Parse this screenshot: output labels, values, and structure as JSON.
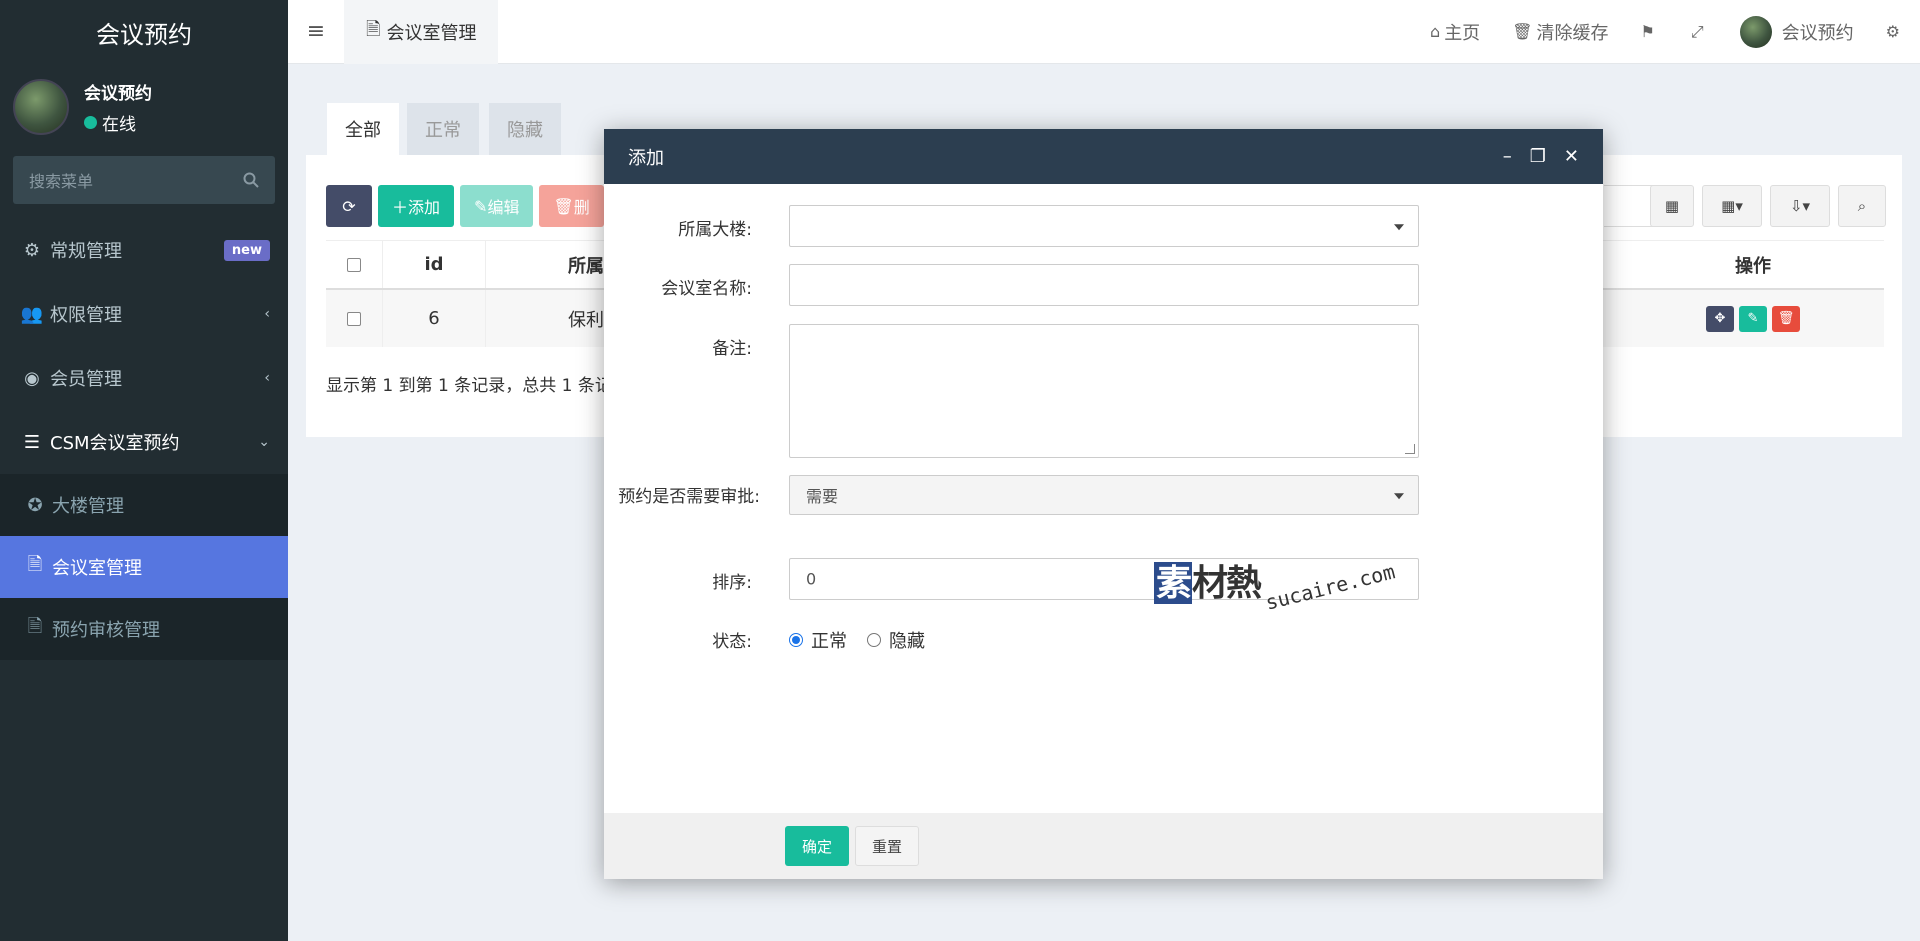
{
  "sidebar": {
    "logo": "会议预约",
    "user": {
      "name": "会议预约",
      "status": "在线"
    },
    "search_placeholder": "搜索菜单",
    "menu": [
      {
        "label": "常规管理",
        "badge": "new",
        "icon": "cogs-icon"
      },
      {
        "label": "权限管理",
        "icon": "users-icon"
      },
      {
        "label": "会员管理",
        "icon": "user-circle-icon"
      },
      {
        "label": "CSM会议室预约",
        "icon": "list-icon"
      }
    ],
    "submenu": [
      {
        "label": "大楼管理",
        "icon": "circle-gear-icon"
      },
      {
        "label": "会议室管理",
        "icon": "file-icon",
        "active": true
      },
      {
        "label": "预约审核管理",
        "icon": "file-icon"
      }
    ]
  },
  "header": {
    "tab": "会议室管理",
    "nav": {
      "home": "主页",
      "clear_cache": "清除缓存",
      "user": "会议预约"
    }
  },
  "content": {
    "tabs": [
      "全部",
      "正常",
      "隐藏"
    ],
    "toolbar": {
      "add": "添加",
      "edit": "编辑",
      "delete": "删"
    },
    "table": {
      "headers": {
        "id": "id",
        "building": "所属",
        "ops": "操作"
      },
      "rows": [
        {
          "id": "6",
          "building": "保利"
        }
      ]
    },
    "pager": "显示第 1 到第 1 条记录，总共 1 条记"
  },
  "modal": {
    "title": "添加",
    "fields": {
      "building_label": "所属大楼:",
      "building_value": "",
      "room_label": "会议室名称:",
      "room_value": "",
      "remark_label": "备注:",
      "remark_value": "",
      "approve_label": "预约是否需要审批:",
      "approve_value": "需要",
      "sort_label": "排序:",
      "sort_value": "0",
      "status_label": "状态:",
      "status_options": [
        "正常",
        "隐藏"
      ],
      "status_selected": "正常"
    },
    "buttons": {
      "ok": "确定",
      "reset": "重置"
    }
  },
  "watermark": {
    "cn": "素材熱",
    "en": "sucaire.com"
  },
  "colors": {
    "sidebar": "#222d32",
    "accent": "#18bc9c",
    "active_menu": "#5676e0",
    "modal_header": "#2c3e50"
  }
}
